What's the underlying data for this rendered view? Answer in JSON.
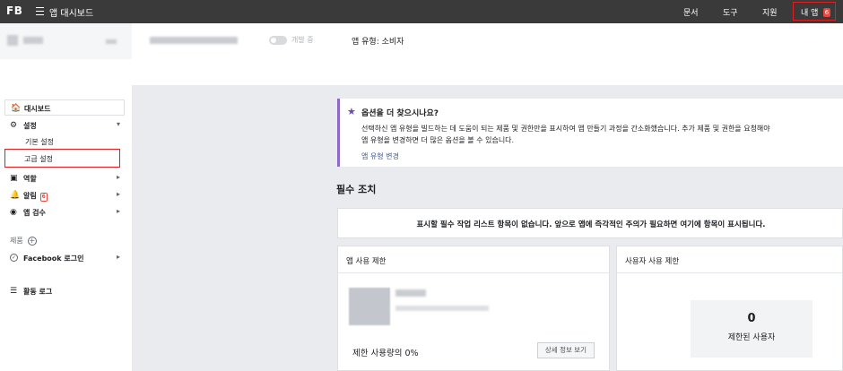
{
  "topbar": {
    "brand": "FB",
    "title": "앱 대시보드",
    "links": [
      "문서",
      "도구",
      "지원"
    ],
    "my_apps_label": "내 앱",
    "my_apps_badge": "6"
  },
  "appbar": {
    "dev_mode_label": "개발 중",
    "app_type": "앱 유형: 소비자"
  },
  "sidebar": {
    "dashboard": "대시보드",
    "settings": "설정",
    "settings_basic": "기본 설정",
    "settings_advanced": "고급 설정",
    "roles": "역할",
    "alerts": "알림",
    "alerts_badge": "6",
    "app_review": "앱 검수",
    "products_label": "제품",
    "facebook_login": "Facebook 로그인",
    "activity_log": "활동 로그"
  },
  "tip": {
    "title": "옵션을 더 찾으시나요?",
    "body_line1": "선택하신 앱 유형을 빌드하는 데 도움이 되는 제품 및 권한만을 표시하여 앱 만들기 과정을 간소화했습니다. 추가 제품 및 권한을 요청해야",
    "body_line2": "앱 유형을 변경하면 더 많은 옵션을 볼 수 있습니다.",
    "link": "앱 유형 변경"
  },
  "required_actions": {
    "title": "필수 조치",
    "empty_message": "표시할 필수 작업 리스트 항목이 없습니다. 앞으로 앱에 즉각적인 주의가 필요하면 여기에 항목이 표시됩니다."
  },
  "app_rate_limit": {
    "title": "앱 사용 제한",
    "usage": "제한 사용량의 0%",
    "details_button": "상세 정보 보기"
  },
  "user_rate_limit": {
    "title": "사용자 사용 제한",
    "count": "0",
    "count_label": "제한된 사용자"
  }
}
